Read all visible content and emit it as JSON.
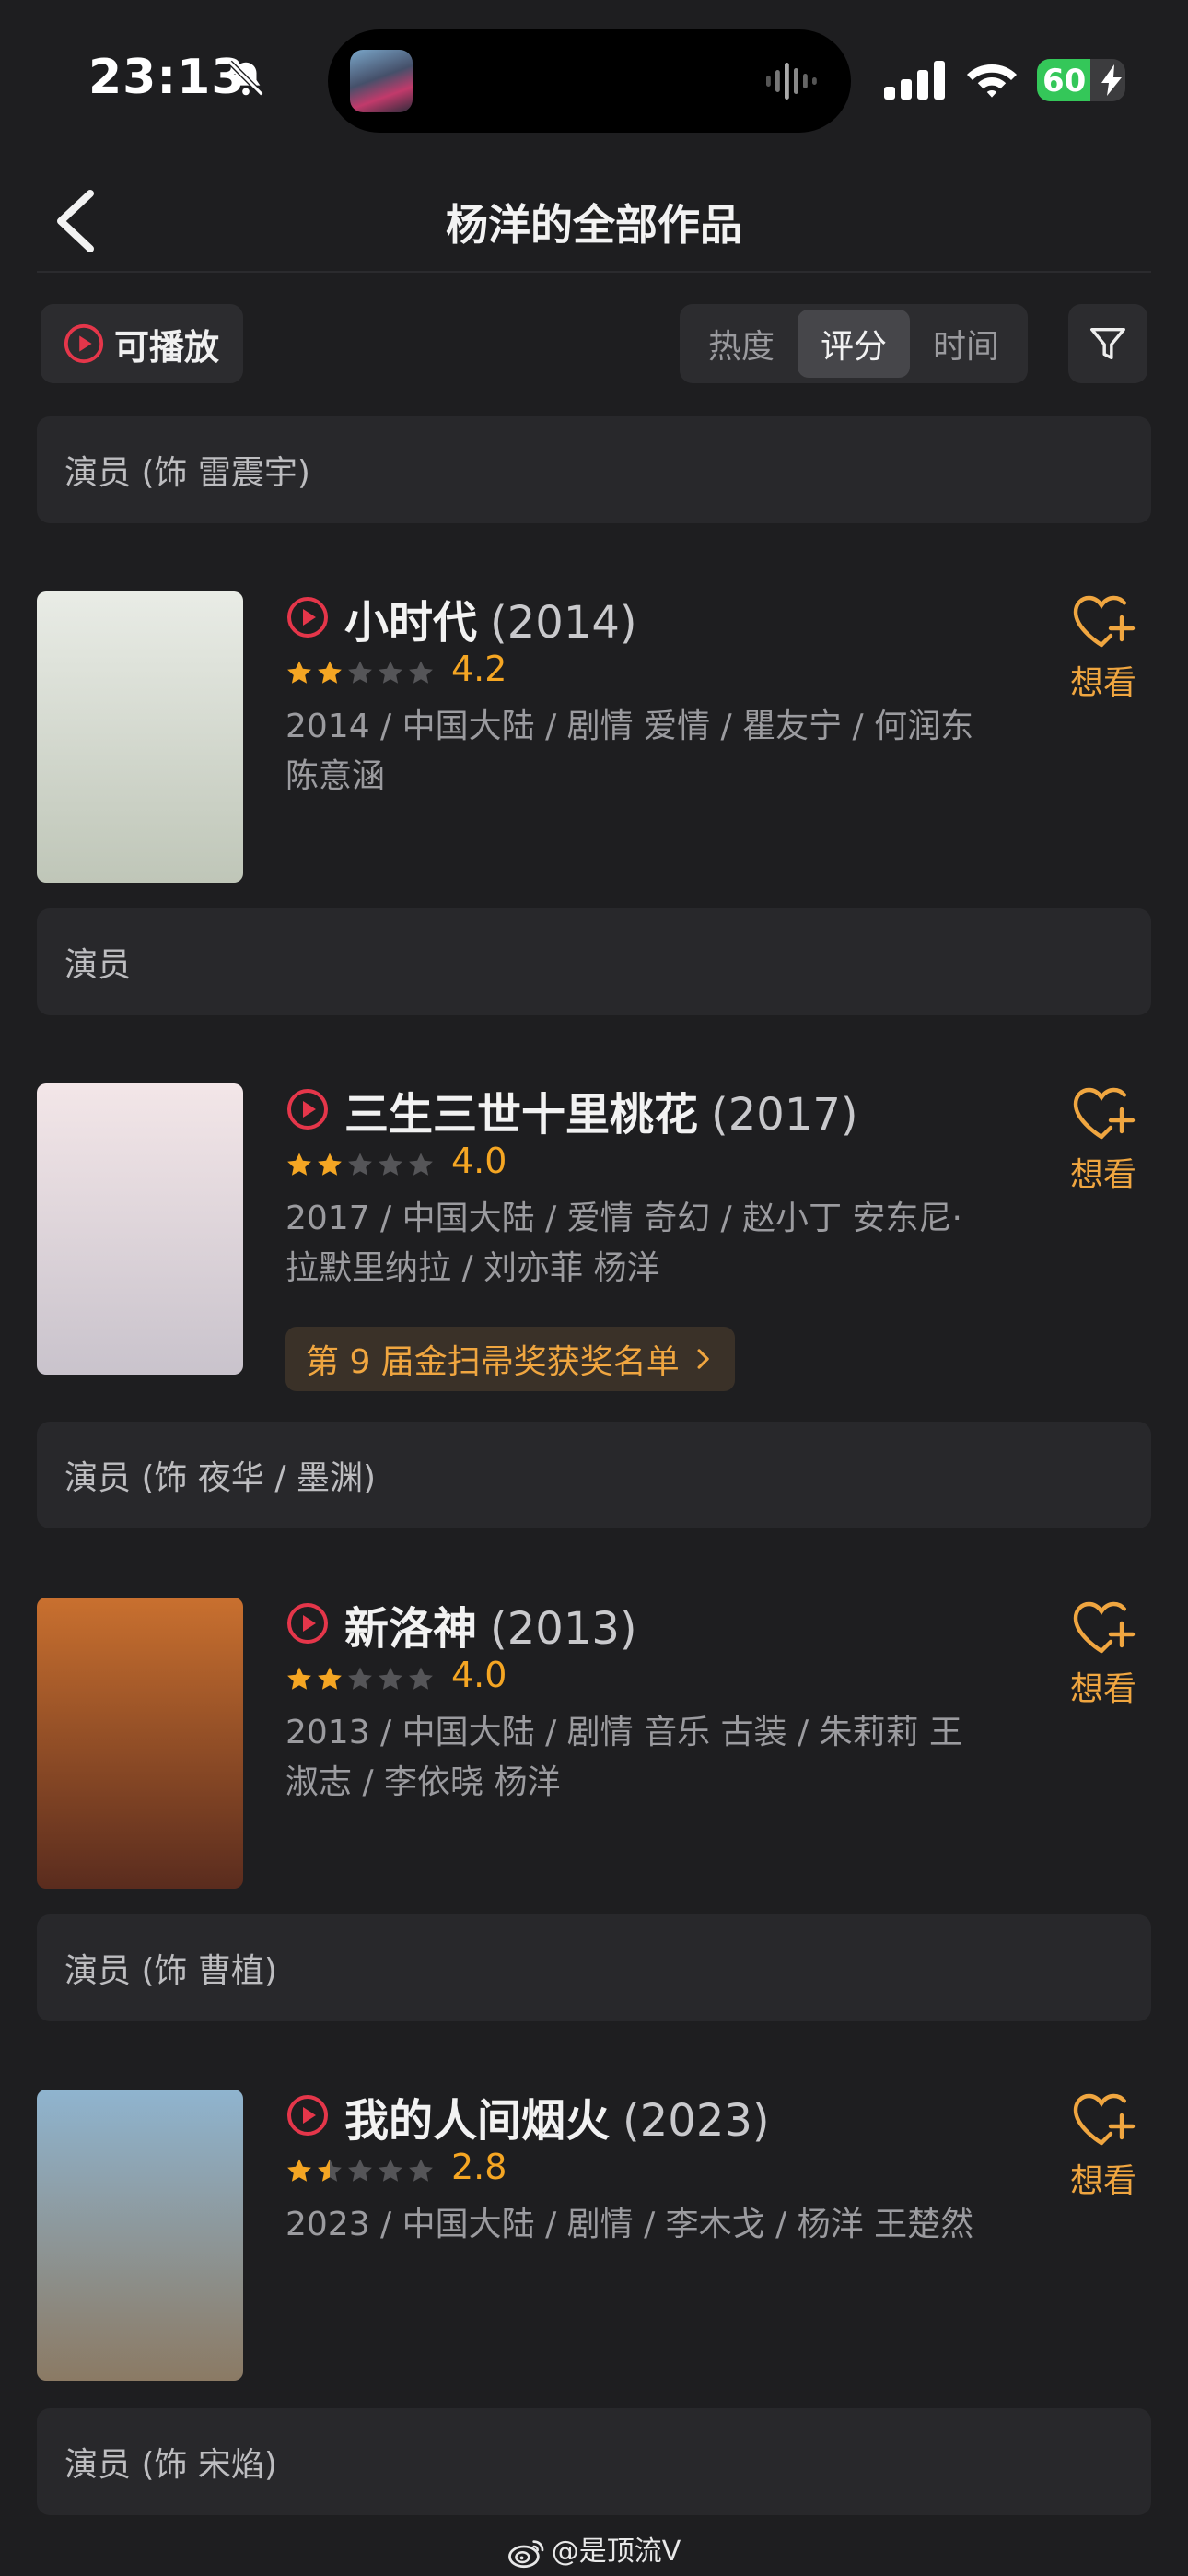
{
  "status_bar": {
    "time": "23:13",
    "battery": "60",
    "battery_level": 0.6
  },
  "nav": {
    "title": "杨洋的全部作品"
  },
  "filters": {
    "playable_label": "可播放",
    "sort_tabs": [
      "热度",
      "评分",
      "时间"
    ],
    "active_sort": "评分"
  },
  "roles": [
    "演员 (饰 雷震宇)",
    "演员",
    "演员 (饰 夜华 / 墨渊)",
    "演员 (饰 曹植)",
    "演员 (饰 宋焰)"
  ],
  "works": [
    {
      "title": "小时代",
      "year": "(2014)",
      "rating": 4.2,
      "rating_text": "4.2",
      "meta": "2014 / 中国大陆 / 剧情 爱情 / 瞿友宁 / 何润东 陈意涵",
      "want": "想看",
      "poster_colors": [
        "#e9ece6",
        "#bfc6b8"
      ]
    },
    {
      "title": "三生三世十里桃花",
      "year": "(2017)",
      "rating": 4.0,
      "rating_text": "4.0",
      "meta": "2017 / 中国大陆 / 爱情 奇幻 / 赵小丁 安东尼·拉默里纳拉 / 刘亦菲 杨洋",
      "award": "第 9 届金扫帚奖获奖名单",
      "want": "想看",
      "poster_colors": [
        "#f3e6e8",
        "#c9c3cc"
      ]
    },
    {
      "title": "新洛神",
      "year": "(2013)",
      "rating": 4.0,
      "rating_text": "4.0",
      "meta": "2013 / 中国大陆 / 剧情 音乐 古装 / 朱莉莉 王淑志 / 李依晓 杨洋",
      "want": "想看",
      "poster_colors": [
        "#c9702f",
        "#5a2c1e"
      ]
    },
    {
      "title": "我的人间烟火",
      "year": "(2023)",
      "rating": 2.8,
      "rating_text": "2.8",
      "meta": "2023 / 中国大陆 / 剧情 / 李木戈 / 杨洋 王楚然",
      "want": "想看",
      "poster_colors": [
        "#8fb4cf",
        "#8b7a64"
      ]
    }
  ],
  "footer": {
    "text": "@是顶流V"
  },
  "colors": {
    "accent": "#f0a640",
    "play_red": "#e5364a",
    "star_on": "#f5a623",
    "star_off": "#555558"
  }
}
